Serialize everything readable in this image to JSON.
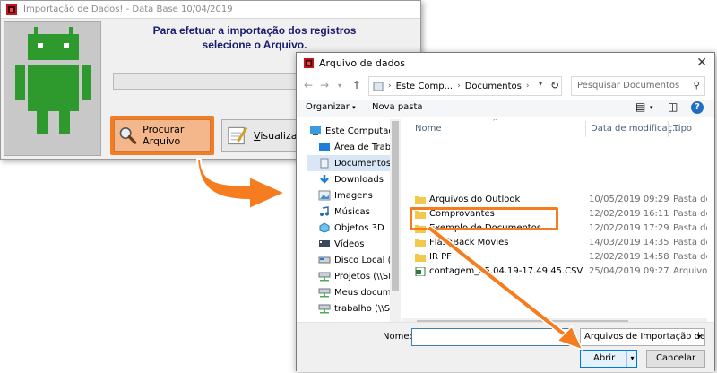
{
  "main_window": {
    "title": "Importação de Dados! - Data Base 10/04/2019",
    "heading_line1": "Para efetuar a importação dos registros",
    "heading_line2": "selecione o Arquivo.",
    "browse_button": {
      "accel": "P",
      "rest": "rocurar Arquivo"
    },
    "view_button": {
      "accel": "V",
      "rest": "isualizar"
    }
  },
  "file_dialog": {
    "title": "Arquivo de dados",
    "close": "✕",
    "breadcrumb": [
      "Este Comp...",
      "Documentos"
    ],
    "search_placeholder": "Pesquisar Documentos",
    "toolbar": {
      "organize": "Organizar",
      "new_folder": "Nova pasta"
    },
    "nav_items": [
      {
        "label": "Este Computador",
        "icon": "computer-icon"
      },
      {
        "label": "Área de Trabalho",
        "icon": "desktop-icon"
      },
      {
        "label": "Documentos",
        "icon": "documents-icon",
        "selected": true
      },
      {
        "label": "Downloads",
        "icon": "downloads-icon"
      },
      {
        "label": "Imagens",
        "icon": "images-icon"
      },
      {
        "label": "Músicas",
        "icon": "music-icon"
      },
      {
        "label": "Objetos 3D",
        "icon": "objects-3d-icon"
      },
      {
        "label": "Vídeos",
        "icon": "videos-icon"
      },
      {
        "label": "Disco Local (C:)",
        "icon": "drive-icon"
      },
      {
        "label": "Projetos (\\\\SERV",
        "icon": "network-drive-icon"
      },
      {
        "label": "Meus document",
        "icon": "network-drive-icon"
      },
      {
        "label": "trabalho (\\\\Servi",
        "icon": "network-drive-icon"
      }
    ],
    "columns": {
      "name": "Nome",
      "date": "Data de modificaç...",
      "type": "Tipo"
    },
    "files": [
      {
        "name": "Arquivos do Outlook",
        "date": "10/05/2019 09:29",
        "type": "Pasta de arqu",
        "kind": "folder"
      },
      {
        "name": "Comprovantes",
        "date": "12/02/2019 16:11",
        "type": "Pasta de arqu",
        "kind": "folder"
      },
      {
        "name": "Exemplo de Documentos",
        "date": "12/02/2019 17:29",
        "type": "Pasta de arqu",
        "kind": "folder"
      },
      {
        "name": "FlashBack Movies",
        "date": "14/03/2019 14:35",
        "type": "Pasta de arqu",
        "kind": "folder"
      },
      {
        "name": "IR PF",
        "date": "12/02/2019 14:58",
        "type": "Pasta de arqu",
        "kind": "folder"
      },
      {
        "name": "contagem_05.04.19-17.49.45.CSV",
        "date": "25/04/2019 09:27",
        "type": "Arquivo de V",
        "kind": "csv"
      }
    ],
    "name_label": "Nome:",
    "name_value": "",
    "file_type": "Arquivos de Importação de dac",
    "open_button": "Abrir",
    "cancel_button": "Cancelar"
  },
  "colors": {
    "highlight": "#f57c1f",
    "android": "#2e9a2e",
    "heading": "#1a1a6e"
  }
}
